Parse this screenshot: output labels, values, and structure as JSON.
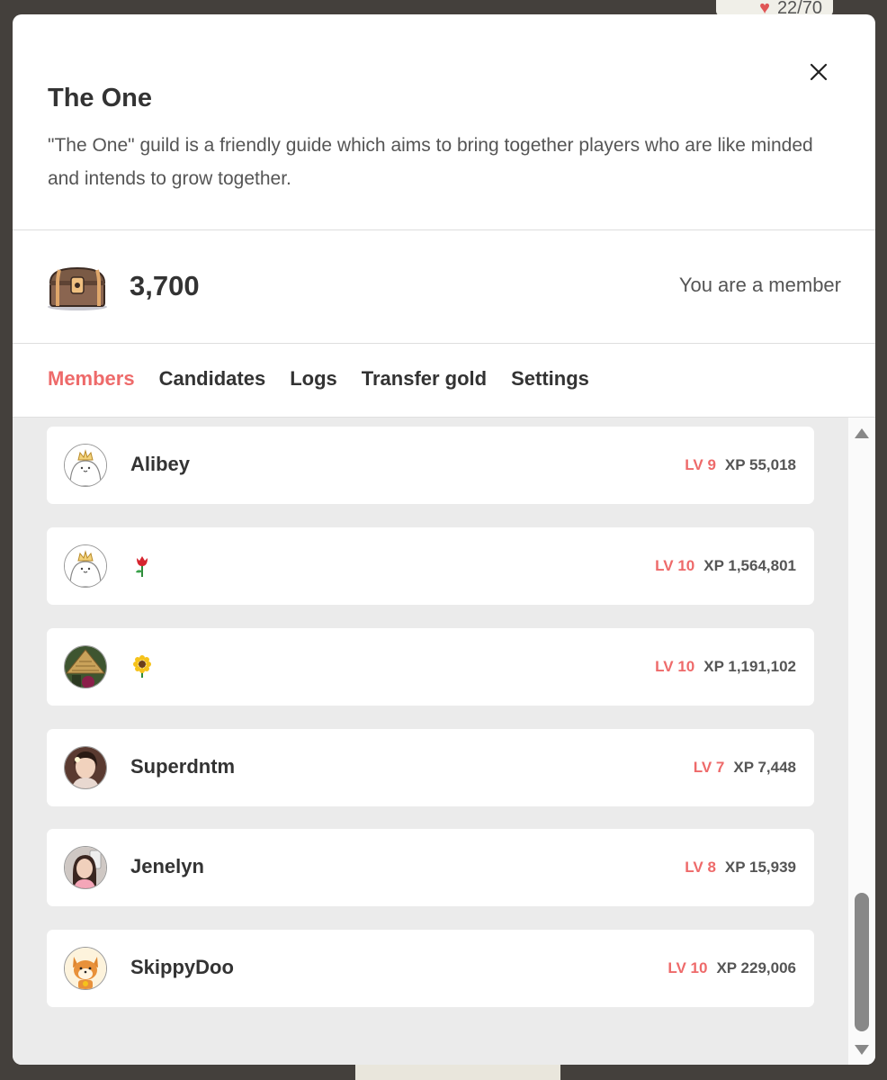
{
  "background": {
    "top_right_text": "22/70"
  },
  "guild": {
    "name": "The One",
    "description": "\"The One\" guild is a friendly guide which aims to bring together players who are like minded and intends to grow together.",
    "gold": "3,700",
    "status": "You are a member"
  },
  "tabs": [
    {
      "label": "Members",
      "active": true
    },
    {
      "label": "Candidates",
      "active": false
    },
    {
      "label": "Logs",
      "active": false
    },
    {
      "label": "Transfer gold",
      "active": false
    },
    {
      "label": "Settings",
      "active": false
    }
  ],
  "members": [
    {
      "name": "Alibey",
      "level": "LV 9",
      "xp": "XP 55,018",
      "avatar": "default-crown-avatar"
    },
    {
      "name": "",
      "name_icon": "rose-emoji",
      "level": "LV 10",
      "xp": "XP 1,564,801",
      "avatar": "default-crown-avatar"
    },
    {
      "name": "",
      "name_icon": "sunflower-emoji",
      "level": "LV 10",
      "xp": "XP 1,191,102",
      "avatar": "hat-photo-avatar"
    },
    {
      "name": "Superdntm",
      "level": "LV 7",
      "xp": "XP 7,448",
      "avatar": "photo-avatar"
    },
    {
      "name": "Jenelyn",
      "level": "LV 8",
      "xp": "XP 15,939",
      "avatar": "photo-avatar"
    },
    {
      "name": "SkippyDoo",
      "level": "LV 10",
      "xp": "XP 229,006",
      "avatar": "shiba-avatar"
    }
  ],
  "colors": {
    "accent": "#ee6a6a",
    "list_background": "#ebebeb",
    "text_dark": "#333333"
  },
  "icons": {
    "close": "close-icon",
    "treasure": "treasure-chest-icon"
  },
  "scrollbar_position": 0.85
}
